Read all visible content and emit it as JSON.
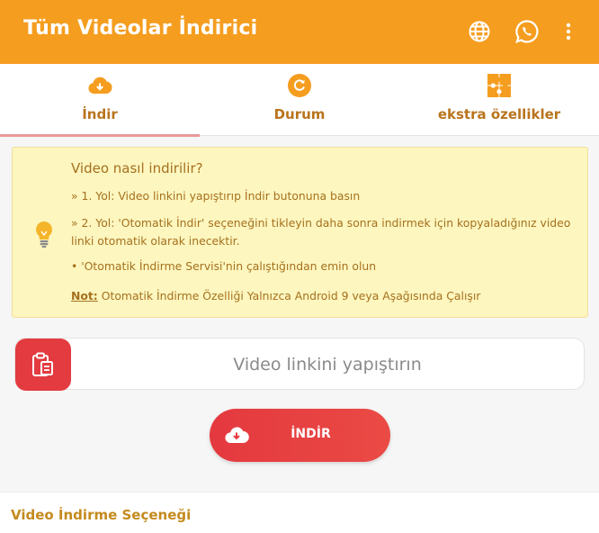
{
  "appbar": {
    "title": "Tüm Videolar İndirici",
    "icons": [
      "globe-icon",
      "whatsapp-icon",
      "more-vert-icon"
    ],
    "color": "#f59d1f"
  },
  "tabs": [
    {
      "label": "İndir",
      "icon": "cloud-download-icon",
      "active": true
    },
    {
      "label": "Durum",
      "icon": "refresh-circle-icon",
      "active": false
    },
    {
      "label": "ekstra özellikler",
      "icon": "puzzle-icon",
      "active": false
    }
  ],
  "info": {
    "title": "Video nasıl indirilir?",
    "line1": "» 1. Yol: Video linkini yapıştırıp İndir butonuna basın",
    "line2": "» 2. Yol: 'Otomatik İndir' seçeneğini tikleyin daha sonra indirmek için kopyaladığınız video linki otomatik olarak inecektir.",
    "line3": "• 'Otomatik İndirme Servisi'nin çalıştığından emin olun",
    "note_label": "Not:",
    "note_text": " Otomatik İndirme Özelliği Yalnızca Android 9 veya Aşağısında Çalışır"
  },
  "link": {
    "placeholder": "Video linkini yapıştırın",
    "paste_icon": "clipboard-paste-icon"
  },
  "download": {
    "label": "İNDİR",
    "icon": "cloud-download-icon",
    "color": "#e4393f"
  },
  "options": {
    "title": "Video İndirme Seçeneği"
  }
}
